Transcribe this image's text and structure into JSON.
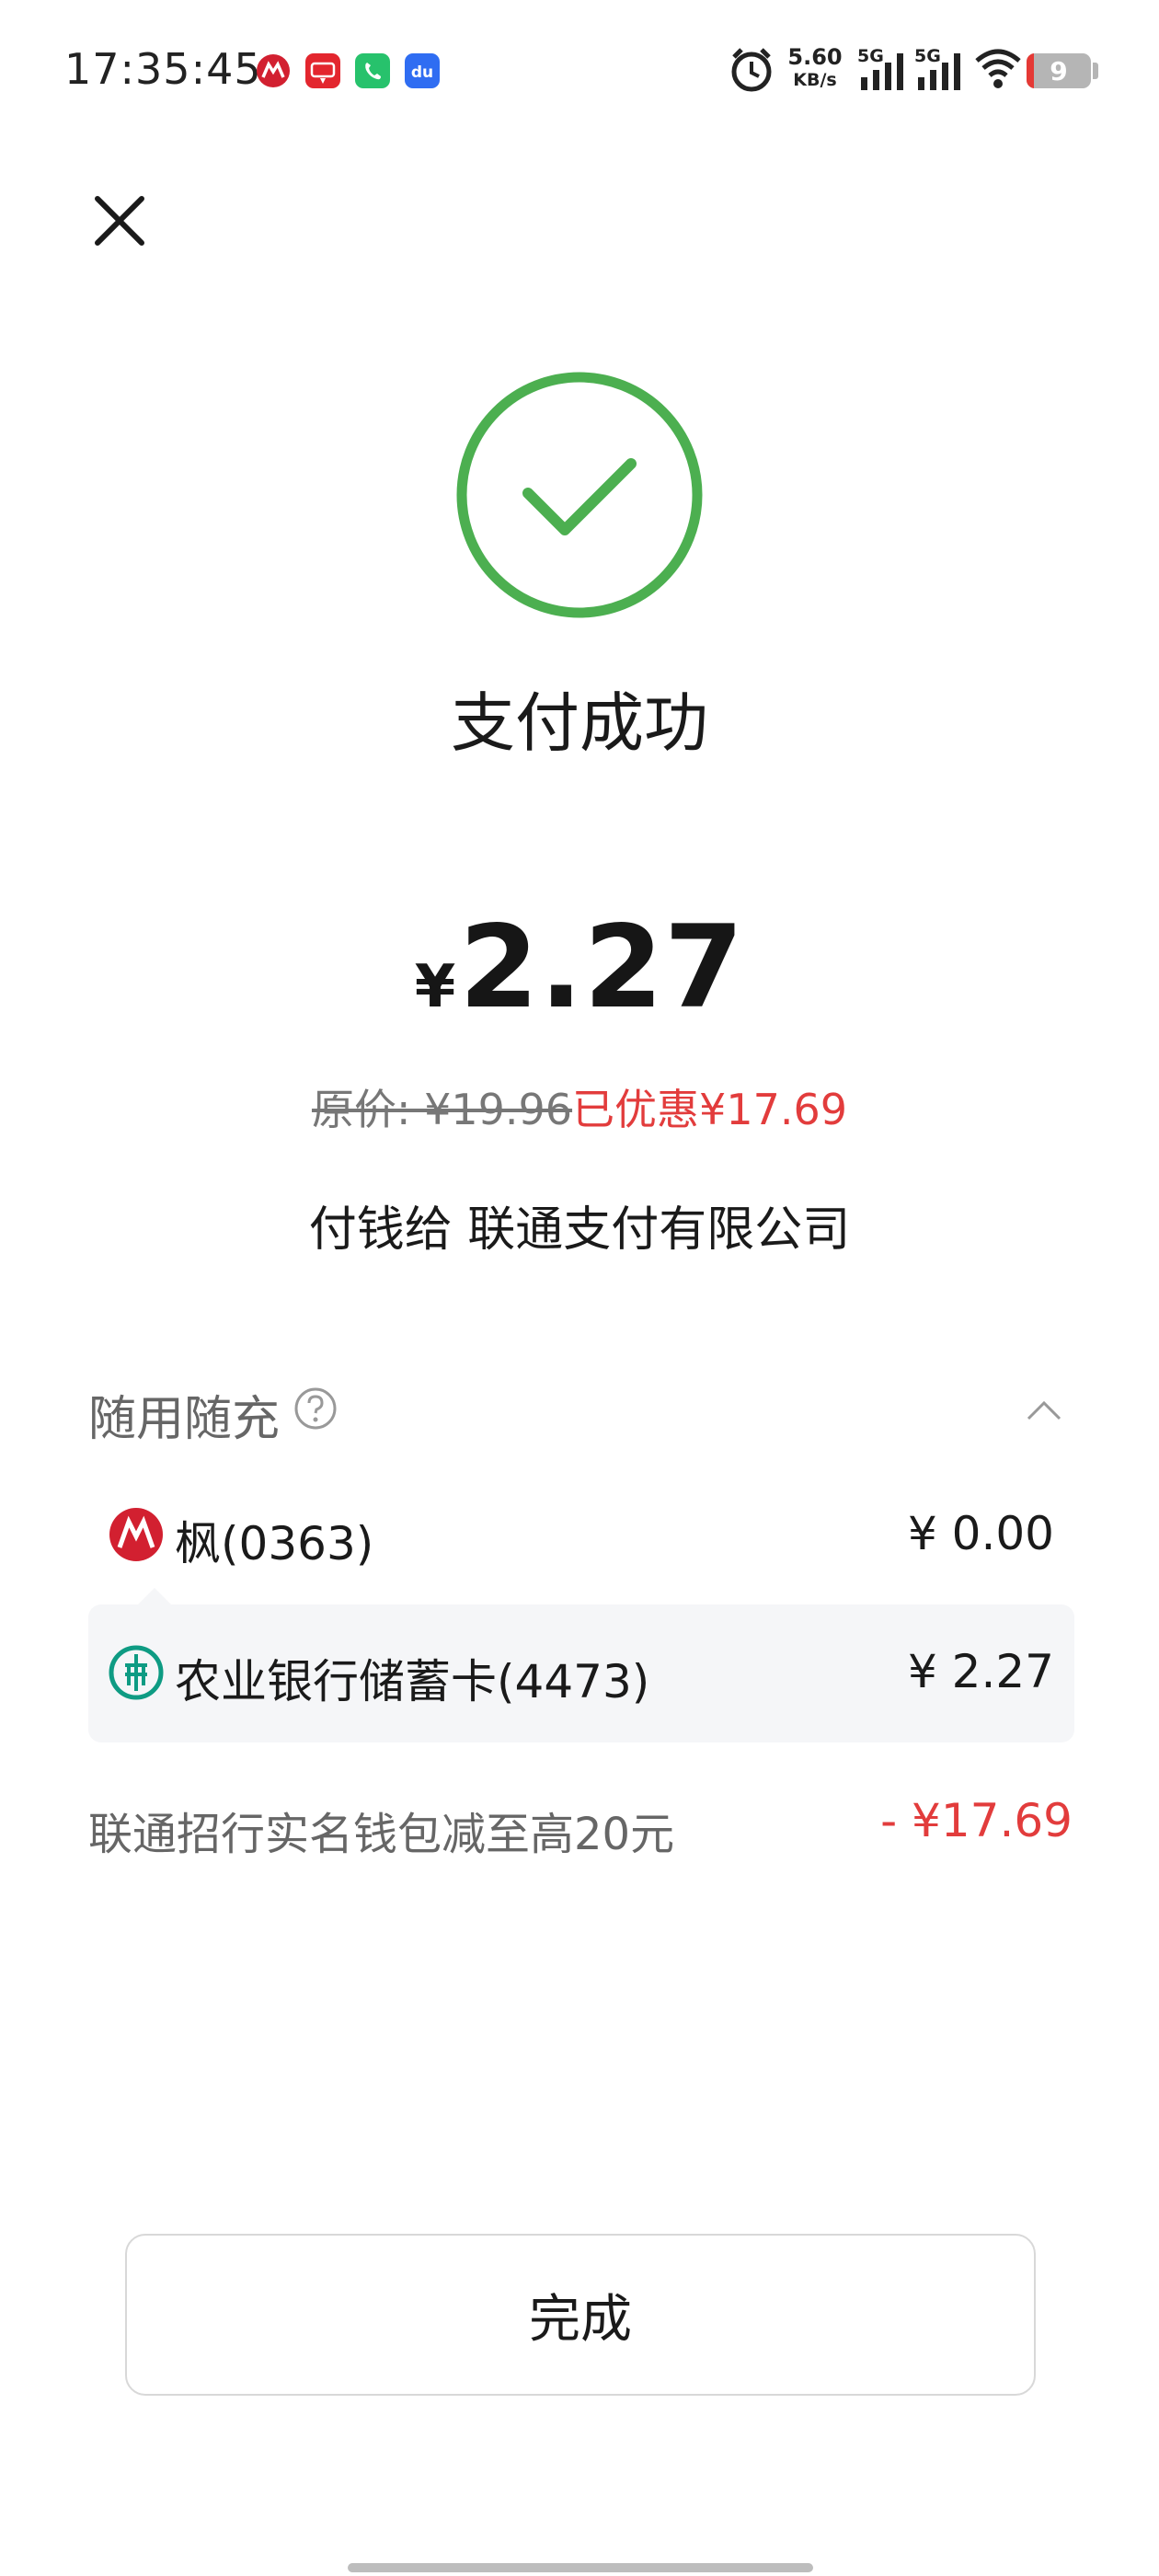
{
  "status_bar": {
    "time": "17:35:45",
    "net_speed_value": "5.60",
    "net_speed_unit": "KB/s",
    "signal_1": "5G",
    "signal_2": "5G",
    "battery": "9",
    "battery_level_percent": 9,
    "notification_icons": [
      "cmb-bank-icon",
      "cloud-pay-icon",
      "phone-app-icon",
      "du-app-icon"
    ],
    "colors": {
      "battery_low": "#e53935"
    }
  },
  "header": {
    "close_icon": "close-icon"
  },
  "result": {
    "icon": "check-circle-icon",
    "title": "支付成功",
    "colors": {
      "success_green": "#4caf50"
    }
  },
  "amount": {
    "currency": "¥",
    "value": "2.27"
  },
  "price": {
    "original": "原价: ¥19.96",
    "discount": "已优惠¥17.69",
    "colors": {
      "discount_red": "#e23c3c"
    }
  },
  "payee": "付钱给 联通支付有限公司",
  "payment_section": {
    "title": "随用随充",
    "help_icon": "question-circle-icon",
    "collapse_icon": "chevron-up-icon",
    "rows": [
      {
        "icon": "cmb-bank-icon",
        "label": "枫(0363)",
        "amount": "¥ 0.00"
      },
      {
        "icon": "abc-bank-icon",
        "label": "农业银行储蓄卡(4473)",
        "amount": "¥ 2.27"
      }
    ]
  },
  "promotion": {
    "label": "联通招行实名钱包减至高20元",
    "amount": "- ¥17.69"
  },
  "done_button": {
    "label": "完成"
  }
}
